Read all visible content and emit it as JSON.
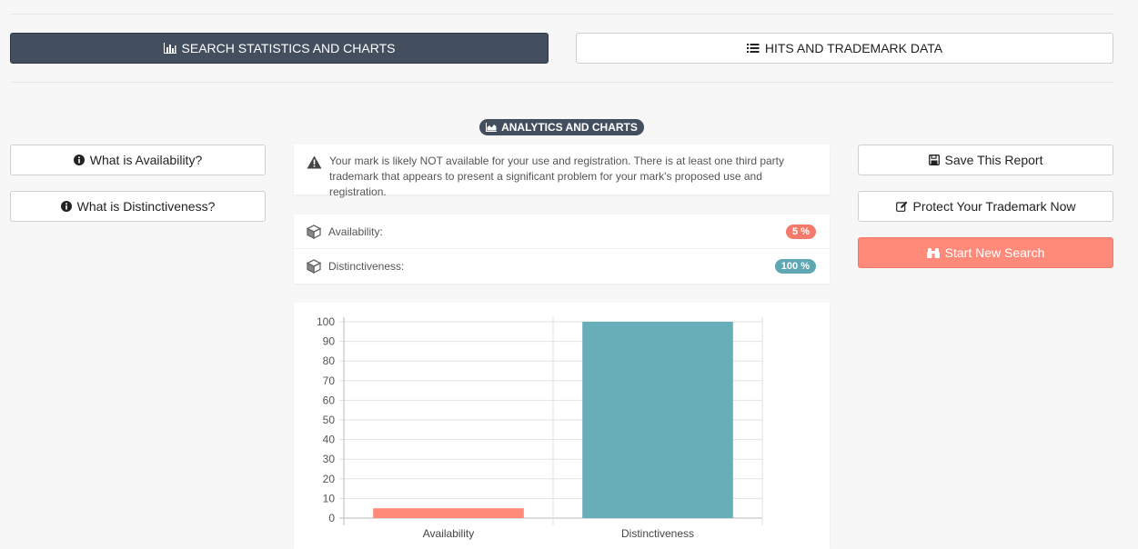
{
  "tabs": {
    "stats_label": "SEARCH STATISTICS AND CHARTS",
    "hits_label": "HITS AND TRADEMARK DATA"
  },
  "section": {
    "badge_label": "ANALYTICS AND CHARTS"
  },
  "help": {
    "availability_label": "What is Availability?",
    "distinctiveness_label": "What is Distinctiveness?"
  },
  "alert": {
    "text": "Your mark is likely NOT available for your use and registration. There is at least one third party trademark that appears to present a significant problem for your mark's proposed use and registration."
  },
  "metrics": {
    "availability_label": "Availability:",
    "availability_value": "5 %",
    "distinctiveness_label": "Distinctiveness:",
    "distinctiveness_value": "100 %"
  },
  "actions": {
    "save_label": "Save This Report",
    "protect_label": "Protect Your Trademark Now",
    "new_search_label": "Start New Search"
  },
  "colors": {
    "availability": "#ff8a7a",
    "distinctiveness": "#67aeb9",
    "header": "#434f5f"
  },
  "chart_data": {
    "type": "bar",
    "categories": [
      "Availability",
      "Distinctiveness"
    ],
    "values": [
      5,
      100
    ],
    "ylim": [
      0,
      100
    ],
    "yticks": [
      0,
      10,
      20,
      30,
      40,
      50,
      60,
      70,
      80,
      90,
      100
    ],
    "colors": [
      "#ff8a7a",
      "#67aeb9"
    ],
    "grid": true
  }
}
